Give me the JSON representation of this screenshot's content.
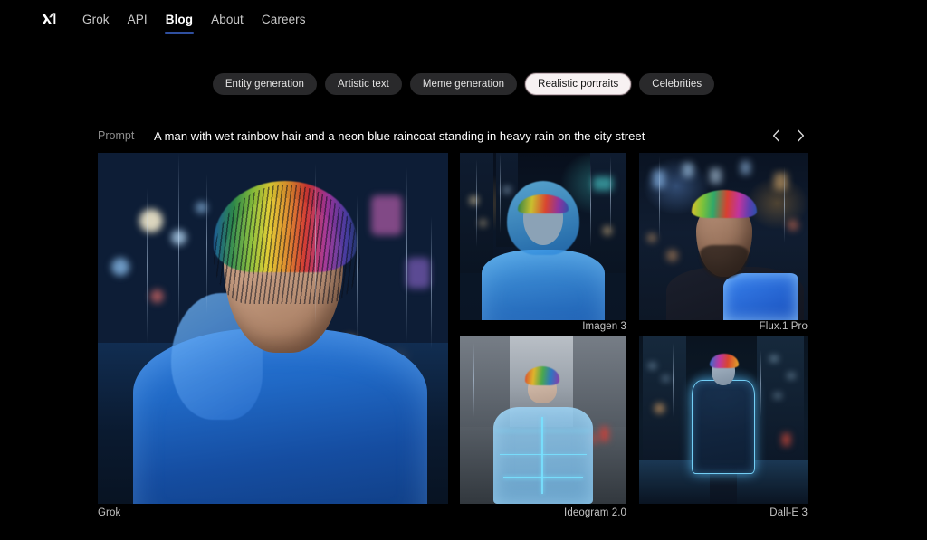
{
  "brand": {
    "logo_alt": "xai-logo"
  },
  "nav": {
    "items": [
      {
        "label": "Grok",
        "active": false
      },
      {
        "label": "API",
        "active": false
      },
      {
        "label": "Blog",
        "active": true
      },
      {
        "label": "About",
        "active": false
      },
      {
        "label": "Careers",
        "active": false
      }
    ]
  },
  "filters": {
    "pills": [
      {
        "label": "Entity generation",
        "selected": false
      },
      {
        "label": "Artistic text",
        "selected": false
      },
      {
        "label": "Meme generation",
        "selected": false
      },
      {
        "label": "Realistic portraits",
        "selected": true
      },
      {
        "label": "Celebrities",
        "selected": false
      }
    ]
  },
  "prompt": {
    "label": "Prompt",
    "text": "A man with wet rainbow hair and a neon blue raincoat standing in heavy rain on the city street",
    "prev_icon": "chevron-left-icon",
    "next_icon": "chevron-right-icon"
  },
  "gallery": {
    "tiles": [
      {
        "caption": "Grok",
        "model": "grok"
      },
      {
        "caption": "Imagen 3",
        "model": "imagen-3"
      },
      {
        "caption": "Flux.1 Pro",
        "model": "flux-1-pro"
      },
      {
        "caption": "Ideogram 2.0",
        "model": "ideogram-2"
      },
      {
        "caption": "Dall-E 3",
        "model": "dall-e-3"
      }
    ]
  },
  "colors": {
    "page_background": "#000000",
    "nav_link": "#c9c9c9",
    "nav_active": "#ffffff",
    "nav_underline": "#2f4f9f",
    "pill_background": "#29292b",
    "pill_text": "#e2e2e2",
    "pill_selected_background": "#f7f1f2",
    "pill_selected_text": "#131313",
    "prompt_label": "#8d8d8d",
    "prompt_text": "#ffffff",
    "caption": "#c4c4c4"
  }
}
